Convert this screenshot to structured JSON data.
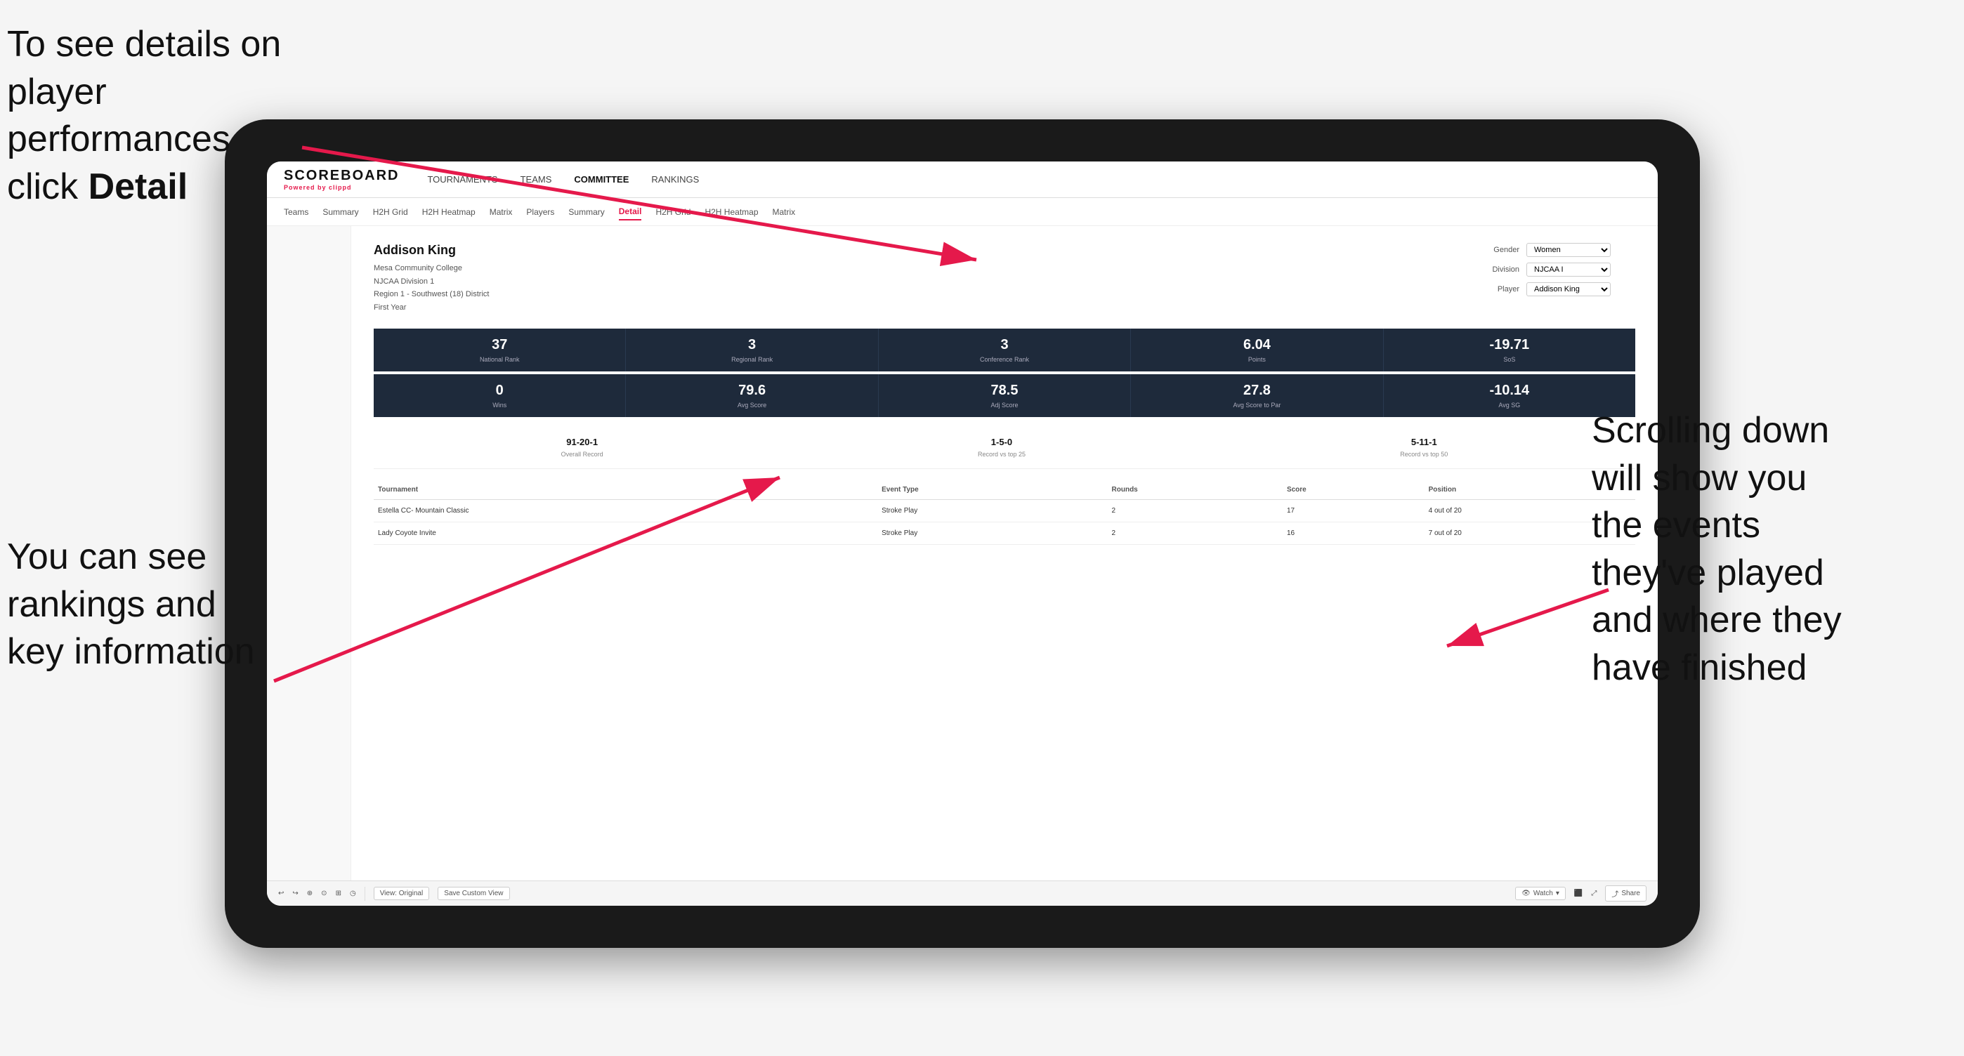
{
  "annotations": {
    "top_left": "To see details on player performances click ",
    "top_left_bold": "Detail",
    "bottom_left_line1": "You can see",
    "bottom_left_line2": "rankings and",
    "bottom_left_line3": "key information",
    "right_line1": "Scrolling down",
    "right_line2": "will show you",
    "right_line3": "the events",
    "right_line4": "they've played",
    "right_line5": "and where they",
    "right_line6": "have finished"
  },
  "nav": {
    "logo": "SCOREBOARD",
    "powered_by": "Powered by ",
    "powered_brand": "clippd",
    "main_items": [
      "TOURNAMENTS",
      "TEAMS",
      "COMMITTEE",
      "RANKINGS"
    ],
    "active_main": "COMMITTEE"
  },
  "sub_nav": {
    "items": [
      "Teams",
      "Summary",
      "H2H Grid",
      "H2H Heatmap",
      "Matrix",
      "Players",
      "Summary",
      "Detail",
      "H2H Grid",
      "H2H Heatmap",
      "Matrix"
    ],
    "active": "Detail"
  },
  "player": {
    "name": "Addison King",
    "college": "Mesa Community College",
    "division": "NJCAA Division 1",
    "region": "Region 1 - Southwest (18) District",
    "year": "First Year"
  },
  "filters": {
    "gender_label": "Gender",
    "gender_value": "Women",
    "division_label": "Division",
    "division_value": "NJCAA I",
    "player_label": "Player",
    "player_value": "Addison King"
  },
  "stats_row1": [
    {
      "value": "37",
      "label": "National Rank"
    },
    {
      "value": "3",
      "label": "Regional Rank"
    },
    {
      "value": "3",
      "label": "Conference Rank"
    },
    {
      "value": "6.04",
      "label": "Points"
    },
    {
      "value": "-19.71",
      "label": "SoS"
    }
  ],
  "stats_row2": [
    {
      "value": "0",
      "label": "Wins"
    },
    {
      "value": "79.6",
      "label": "Avg Score"
    },
    {
      "value": "78.5",
      "label": "Adj Score"
    },
    {
      "value": "27.8",
      "label": "Avg Score to Par"
    },
    {
      "value": "-10.14",
      "label": "Avg SG"
    }
  ],
  "records": [
    {
      "value": "91-20-1",
      "label": "Overall Record"
    },
    {
      "value": "1-5-0",
      "label": "Record vs top 25"
    },
    {
      "value": "5-11-1",
      "label": "Record vs top 50"
    }
  ],
  "table": {
    "headers": [
      "Tournament",
      "Event Type",
      "Rounds",
      "Score",
      "Position"
    ],
    "rows": [
      {
        "tournament": "Estella CC- Mountain Classic",
        "event_type": "Stroke Play",
        "rounds": "2",
        "score": "17",
        "position": "4 out of 20"
      },
      {
        "tournament": "Lady Coyote Invite",
        "event_type": "Stroke Play",
        "rounds": "2",
        "score": "16",
        "position": "7 out of 20"
      }
    ]
  },
  "toolbar": {
    "view_original": "View: Original",
    "save_custom": "Save Custom View",
    "watch": "Watch",
    "share": "Share"
  }
}
